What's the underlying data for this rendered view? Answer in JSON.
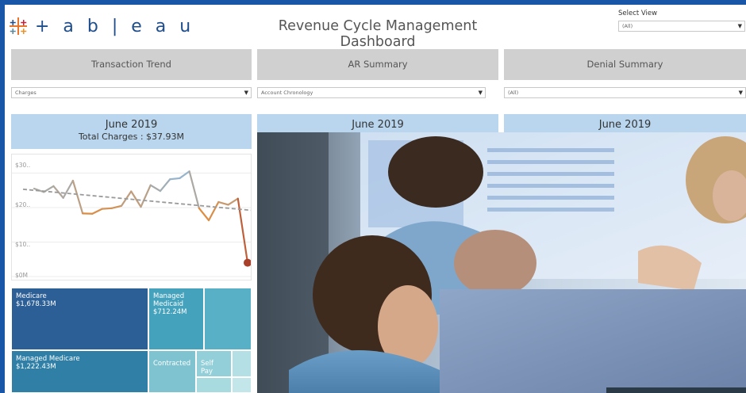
{
  "header": {
    "logo_text": "+ a b | e a u",
    "title": "Revenue Cycle Management Dashboard",
    "select_view_label": "Select View",
    "select_view_value": "(All)"
  },
  "tabs": [
    {
      "label": "Transaction Trend"
    },
    {
      "label": "AR Summary"
    },
    {
      "label": "Denial Summary"
    }
  ],
  "filters": [
    {
      "value": "Charges"
    },
    {
      "value": "Account Chronology"
    },
    {
      "value": "(All)"
    }
  ],
  "panels": [
    {
      "period": "June 2019",
      "subtitle": "Total Charges : $37.93M"
    },
    {
      "period": "June 2019"
    },
    {
      "period": "June 2019"
    }
  ],
  "chart_data": {
    "type": "line",
    "ylabels": [
      "$30..",
      "$20..",
      "$10..",
      "$0M"
    ],
    "ylim": [
      0,
      34
    ],
    "values": [
      25.5,
      24.5,
      26.2,
      22.8,
      27.8,
      18.3,
      18.2,
      19.6,
      19.8,
      20.5,
      24.7,
      20.2,
      26.5,
      24.8,
      28.2,
      28.5,
      30.5,
      19.8,
      16.3,
      21.6,
      20.8,
      22.6,
      4.0
    ],
    "trend": [
      25.3,
      19.2
    ],
    "colors": {
      "high": "#97b4cc",
      "low": "#e08b3c",
      "trend": "#9a9a9a",
      "end_point": "#a9412a"
    }
  },
  "treemap": [
    {
      "label": "Medicare",
      "value": "$1,678.33M",
      "color": "#2c5f96"
    },
    {
      "label": "Managed Medicaid",
      "value": "$712.24M",
      "color": "#45a2bd"
    },
    {
      "label": "Managed Medicare",
      "value": "$1,222.43M",
      "color": "#2f7fa6"
    },
    {
      "label": "Contracted",
      "value": "",
      "color": "#7ec3cf"
    },
    {
      "label": "Self Pay",
      "value": "",
      "color": "#93cfd8"
    }
  ]
}
